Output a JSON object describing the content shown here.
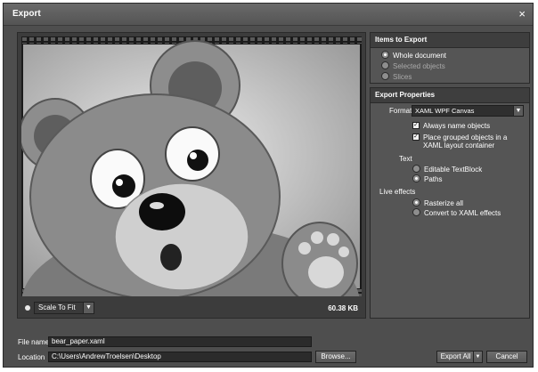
{
  "dialog": {
    "title": "Export",
    "close_glyph": "×"
  },
  "preview": {
    "scale_option": "Scale To Fit",
    "file_size": "60.38 KB"
  },
  "items_to_export": {
    "heading": "Items to Export",
    "options": [
      {
        "label": "Whole document",
        "selected": true,
        "enabled": true
      },
      {
        "label": "Selected objects",
        "selected": false,
        "enabled": false
      },
      {
        "label": "Slices",
        "selected": false,
        "enabled": false
      }
    ]
  },
  "export_properties": {
    "heading": "Export Properties",
    "format_label": "Format",
    "format_value": "XAML WPF Canvas",
    "checkboxes": [
      {
        "label": "Always name objects",
        "checked": true
      },
      {
        "label": "Place grouped objects in a XAML layout container",
        "checked": true
      }
    ],
    "text_label": "Text",
    "text_options": [
      {
        "label": "Editable TextBlock",
        "selected": false
      },
      {
        "label": "Paths",
        "selected": true
      }
    ],
    "live_effects_label": "Live effects",
    "live_effects_options": [
      {
        "label": "Rasterize all",
        "selected": true
      },
      {
        "label": "Convert to XAML effects",
        "selected": false
      }
    ]
  },
  "file": {
    "name_label": "File name",
    "name_value": "bear_paper.xaml",
    "location_label": "Location",
    "location_value": "C:\\Users\\AndrewTroelsen\\Desktop",
    "browse_label": "Browse..."
  },
  "buttons": {
    "export_label": "Export All",
    "cancel_label": "Cancel"
  }
}
